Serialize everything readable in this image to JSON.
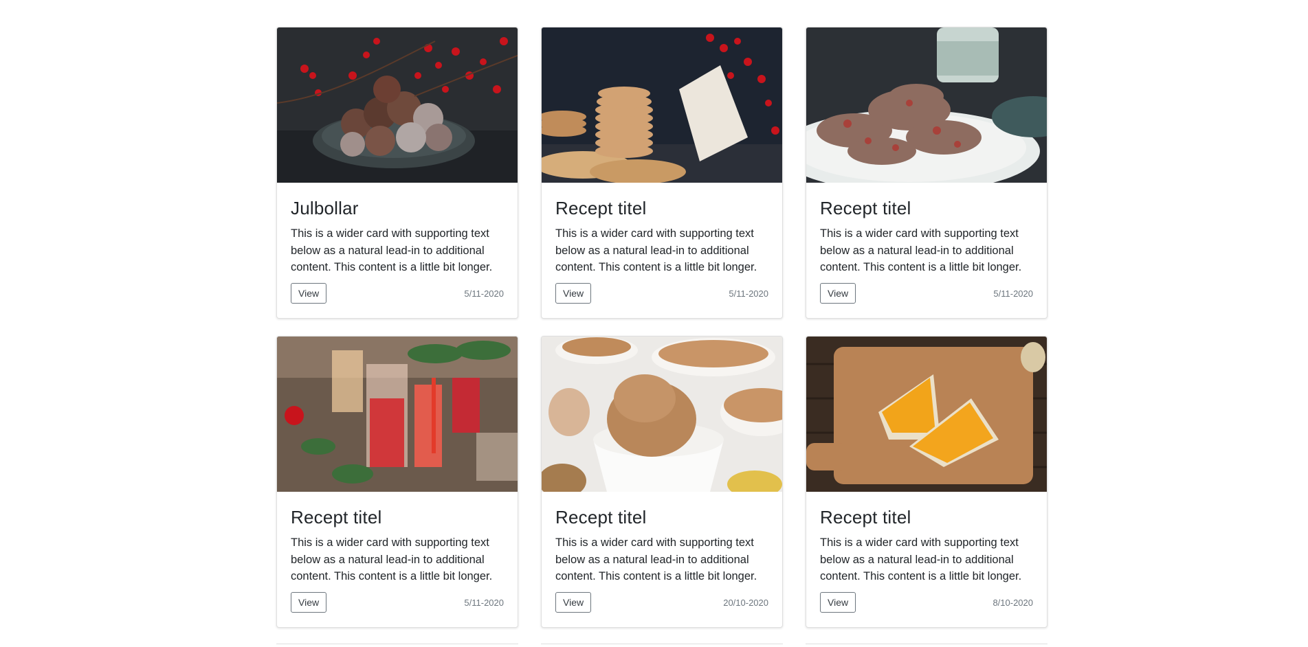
{
  "cards": [
    {
      "title": "Julbollar",
      "text": "This is a wider card with supporting text below as a natural lead-in to additional content. This content is a little bit longer.",
      "button": "View",
      "date": "5/11-2020",
      "image": "truffles-photo"
    },
    {
      "title": "Recept titel",
      "text": "This is a wider card with supporting text below as a natural lead-in to additional content. This content is a little bit longer.",
      "button": "View",
      "date": "5/11-2020",
      "image": "cookies-photo"
    },
    {
      "title": "Recept titel",
      "text": "This is a wider card with supporting text below as a natural lead-in to additional content. This content is a little bit longer.",
      "button": "View",
      "date": "5/11-2020",
      "image": "bark-photo"
    },
    {
      "title": "Recept titel",
      "text": "This is a wider card with supporting text below as a natural lead-in to additional content. This content is a little bit longer.",
      "button": "View",
      "date": "5/11-2020",
      "image": "cocktails-photo"
    },
    {
      "title": "Recept titel",
      "text": "This is a wider card with supporting text below as a natural lead-in to additional content. This content is a little bit longer.",
      "button": "View",
      "date": "20/10-2020",
      "image": "crumble-photo"
    },
    {
      "title": "Recept titel",
      "text": "This is a wider card with supporting text below as a natural lead-in to additional content. This content is a little bit longer.",
      "button": "View",
      "date": "8/10-2020",
      "image": "pie-photo"
    }
  ]
}
